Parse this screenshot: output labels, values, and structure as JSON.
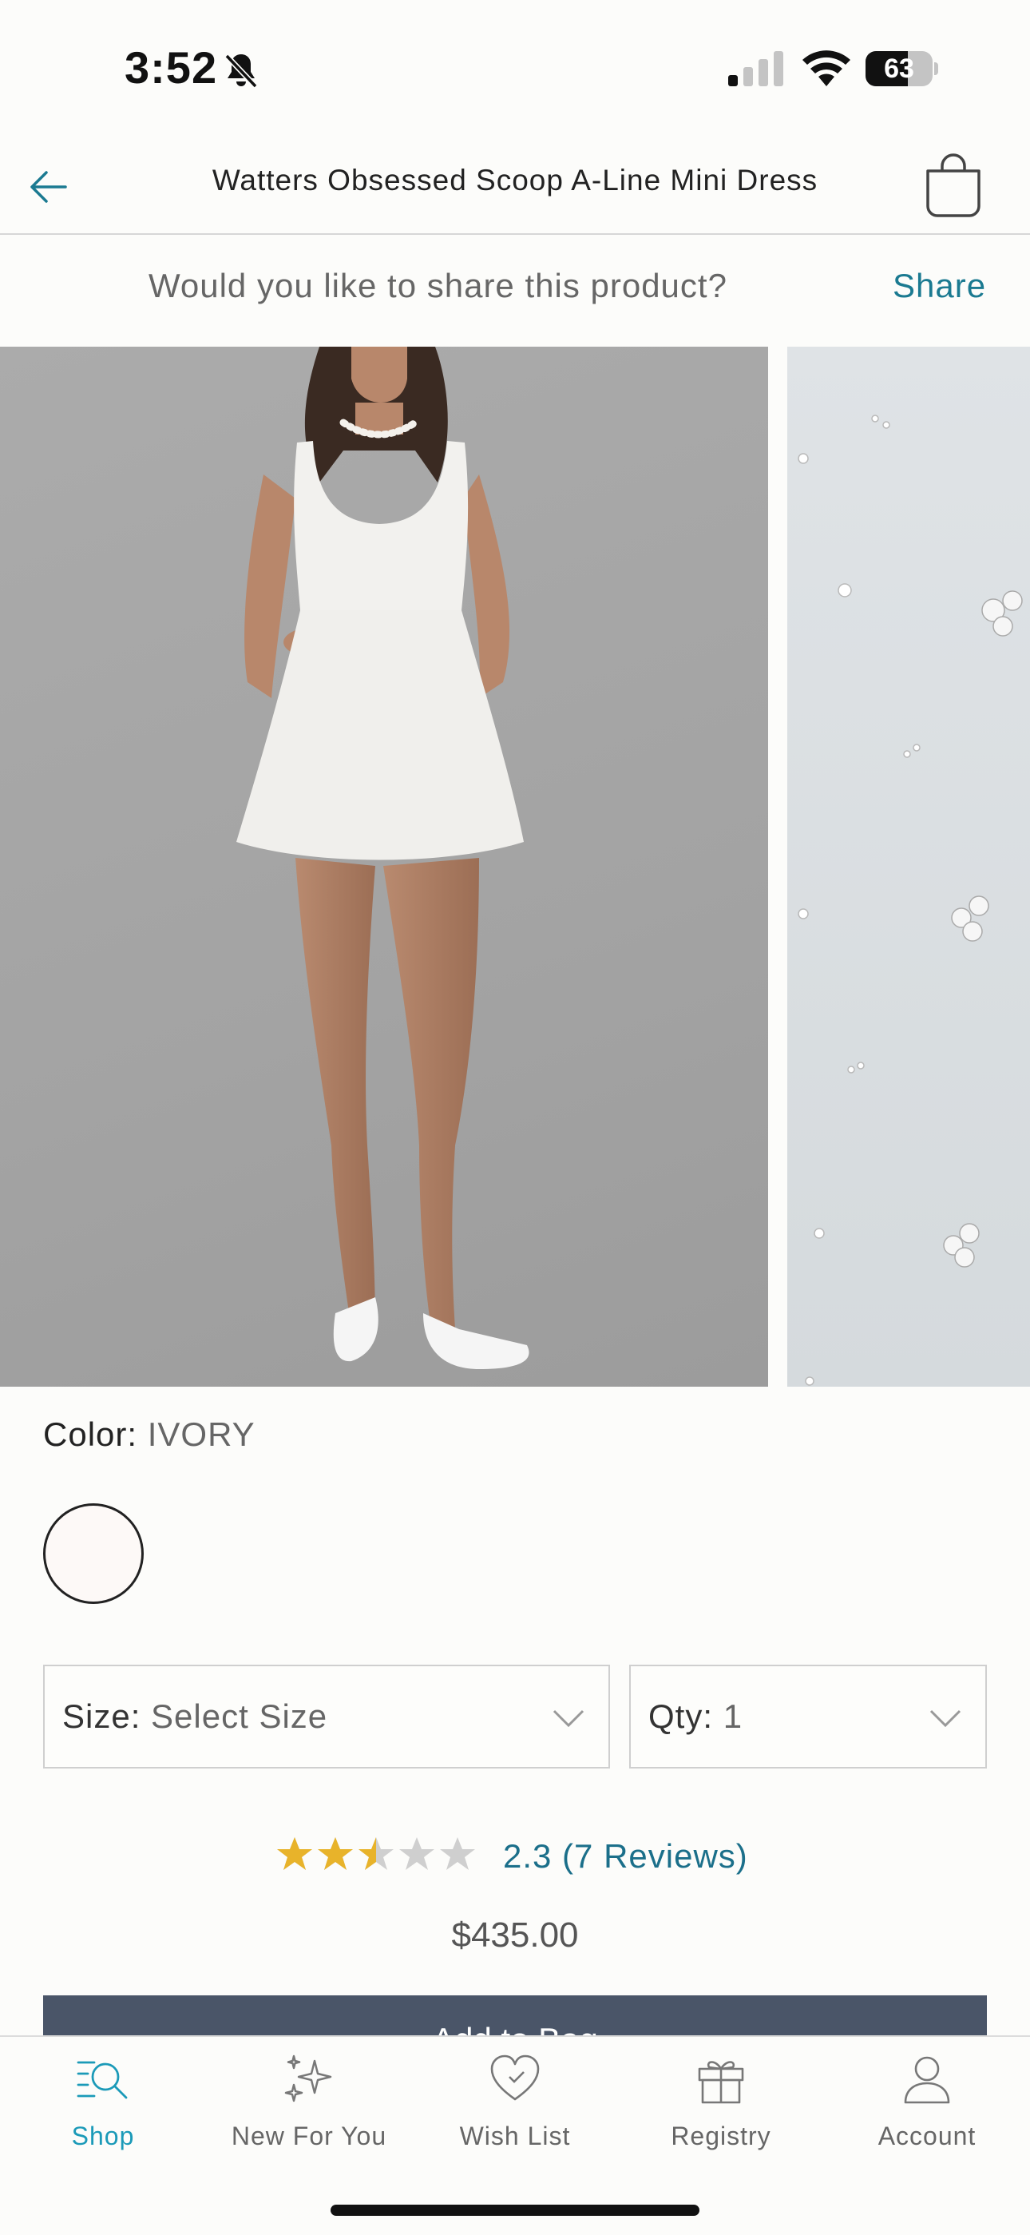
{
  "status_bar": {
    "time": "3:52",
    "battery": "63",
    "battery_level": 0.63
  },
  "header": {
    "title": "Watters Obsessed Scoop A-Line Mini Dress",
    "back_icon": "arrow-left-icon",
    "bag_icon": "shopping-bag-icon"
  },
  "share": {
    "question": "Would you like to share this product?",
    "link": "Share"
  },
  "gallery": {
    "images": [
      {
        "icon": "dress-model-photo"
      },
      {
        "icon": "fabric-detail-photo"
      }
    ]
  },
  "color": {
    "label": "Color:",
    "value": "IVORY",
    "swatch_color": "#fdf9f7"
  },
  "size": {
    "label": "Size:",
    "value": "Select Size"
  },
  "qty": {
    "label": "Qty:",
    "value": "1"
  },
  "rating": {
    "stars": 2.5,
    "max": 5,
    "text": "2.3 (7 Reviews)",
    "star_color": "#e8b32a",
    "empty_color": "#cfcfcf"
  },
  "price": "$435.00",
  "add_to_bag": {
    "label": "Add to Bag"
  },
  "tabs": [
    {
      "label": "Shop",
      "icon": "search-list-icon",
      "active": true
    },
    {
      "label": "New For You",
      "icon": "sparkles-icon",
      "active": false
    },
    {
      "label": "Wish List",
      "icon": "heart-icon",
      "active": false
    },
    {
      "label": "Registry",
      "icon": "gift-icon",
      "active": false
    },
    {
      "label": "Account",
      "icon": "person-icon",
      "active": false
    }
  ],
  "colors": {
    "accent": "#1b9ab8",
    "link": "#1b7a91",
    "button": "#4a5568"
  }
}
